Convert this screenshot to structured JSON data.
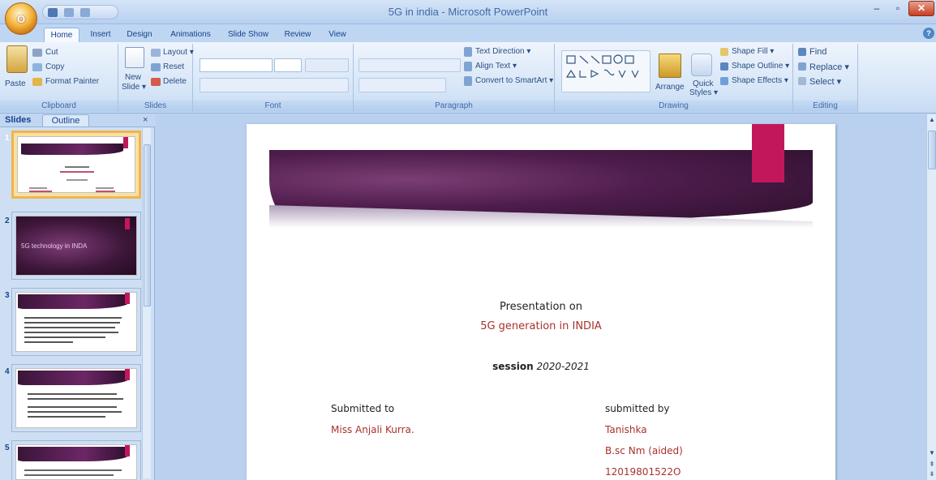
{
  "window": {
    "title": "5G in india - Microsoft PowerPoint",
    "office_button_label": "O",
    "minimize": "–",
    "maximize": "▫",
    "close": "✕"
  },
  "tabs": [
    "Home",
    "Insert",
    "Design",
    "Animations",
    "Slide Show",
    "Review",
    "View"
  ],
  "ribbon": {
    "clipboard": {
      "name": "Clipboard",
      "paste": "Paste",
      "cut": "Cut",
      "copy": "Copy",
      "format_painter": "Format Painter"
    },
    "slides": {
      "name": "Slides",
      "new_slide": "New",
      "new_slide2": "Slide ▾",
      "layout": "Layout ▾",
      "reset": "Reset",
      "delete": "Delete"
    },
    "font": {
      "name": "Font"
    },
    "paragraph": {
      "name": "Paragraph",
      "text_direction": "Text Direction ▾",
      "align_text": "Align Text ▾",
      "convert_smartart": "Convert to SmartArt ▾"
    },
    "drawing": {
      "name": "Drawing",
      "arrange": "Arrange",
      "quick_styles": "Quick",
      "quick_styles2": "Styles ▾",
      "shape_fill": "Shape Fill ▾",
      "shape_outline": "Shape Outline ▾",
      "shape_effects": "Shape Effects ▾"
    },
    "editing": {
      "name": "Editing",
      "find": "Find",
      "replace": "Replace ▾",
      "select": "Select ▾"
    }
  },
  "left_panel": {
    "tab_slides": "Slides",
    "tab_outline": "Outline",
    "close": "×",
    "thumb2_text": "5G technology in INDA",
    "slide_numbers": [
      "1",
      "2",
      "3",
      "4",
      "5"
    ]
  },
  "slide": {
    "line1": "Presentation on",
    "line2": "5G generation in INDIA",
    "session_label": "session",
    "session_value": "2020-2021",
    "submitted_to_label": "Submitted to",
    "submitted_to_name": "Miss Anjali Kurra.",
    "submitted_by_label": "submitted by",
    "submitted_by_name": "Tanishka",
    "course": "B.sc Nm (aided)",
    "roll": "12019801522O"
  },
  "colors": {
    "accent_pink": "#c2185b",
    "band_purple": "#4d1c4b",
    "text_red": "#a8322c"
  }
}
